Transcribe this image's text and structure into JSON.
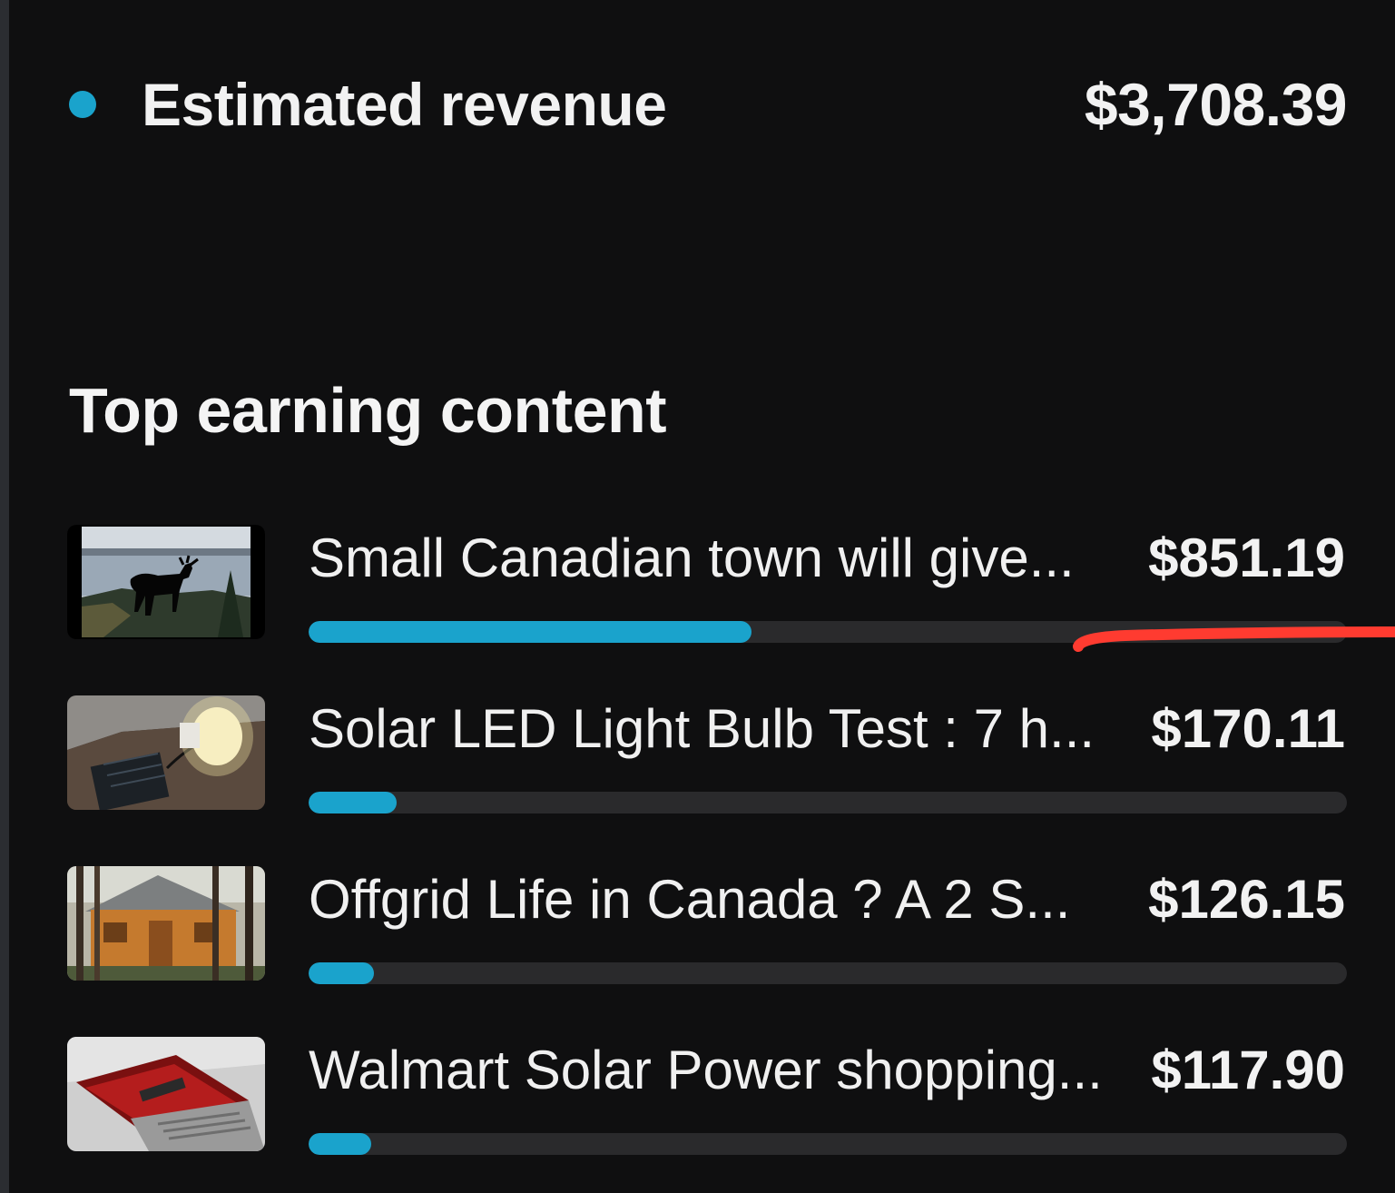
{
  "revenue": {
    "label": "Estimated revenue",
    "value": "$3,708.39",
    "dot_color": "#1aa3cc"
  },
  "top_content": {
    "title": "Top earning content",
    "bar_color": "#1aa3cc",
    "items": [
      {
        "title": "Small Canadian town will give...",
        "value": "$851.19",
        "progress": 0.427,
        "thumbnail": "moose-silhouette-lake-thumbnail"
      },
      {
        "title": "Solar LED Light Bulb Test : 7 h...",
        "value": "$170.11",
        "progress": 0.085,
        "thumbnail": "solar-led-bulb-thumbnail"
      },
      {
        "title": "Offgrid Life in Canada ? A 2 S...",
        "value": "$126.15",
        "progress": 0.063,
        "thumbnail": "wooden-cabin-thumbnail"
      },
      {
        "title": "Walmart Solar Power shopping...",
        "value": "$117.90",
        "progress": 0.06,
        "thumbnail": "power-inverter-box-thumbnail"
      }
    ]
  },
  "annotation": {
    "color": "#ff3b30"
  }
}
